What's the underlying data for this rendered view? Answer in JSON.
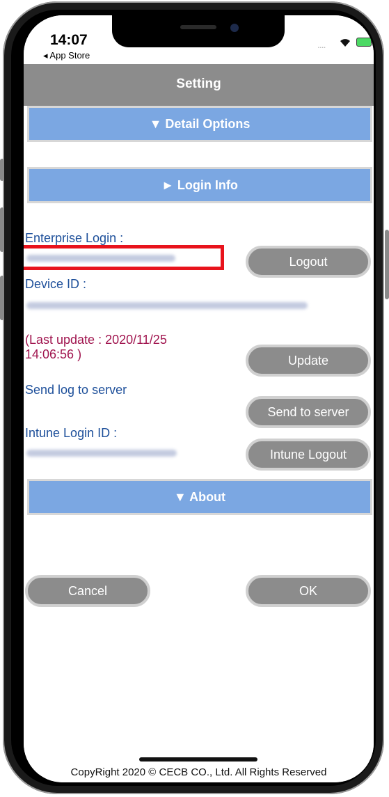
{
  "status": {
    "time": "14:07",
    "back_app": "◂ App Store",
    "signal": "....",
    "wifi_icon": "wifi-icon",
    "battery_icon": "battery-charging-icon"
  },
  "nav": {
    "title": "Setting"
  },
  "sections": {
    "detail_options": "▼ Detail Options",
    "login_info": "► Login Info",
    "about": "▼ About"
  },
  "login": {
    "enterprise_label": "Enterprise Login :",
    "logout_button": "Logout",
    "device_id_label": "Device ID :",
    "last_update": "(Last update : 2020/11/25 14:06:56 )",
    "update_button": "Update",
    "send_log_label": "Send log to server",
    "send_button": "Send to server",
    "intune_label": "Intune Login ID :",
    "intune_logout_button": "Intune Logout"
  },
  "actions": {
    "cancel": "Cancel",
    "ok": "OK"
  },
  "footer": {
    "copyright": "CopyRight 2020 © CECB CO., Ltd. All Rights Reserved"
  },
  "colors": {
    "section_blue": "#7ba7e2",
    "nav_gray": "#8c8c8c",
    "label_blue": "#1d4f9a",
    "update_red": "#a0144e",
    "highlight_red": "#e8131c"
  }
}
